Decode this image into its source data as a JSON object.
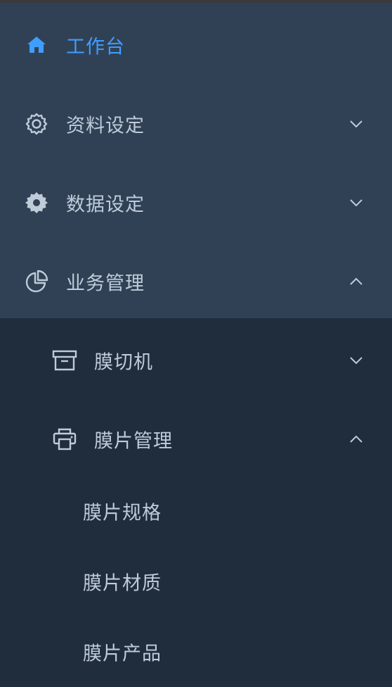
{
  "menu": {
    "items": [
      {
        "label": "工作台",
        "icon": "home-icon",
        "active": true
      },
      {
        "label": "资料设定",
        "icon": "gear-outline-icon",
        "expanded": false
      },
      {
        "label": "数据设定",
        "icon": "gear-filled-icon",
        "expanded": false
      },
      {
        "label": "业务管理",
        "icon": "pie-chart-icon",
        "expanded": true
      }
    ],
    "business_children": [
      {
        "label": "膜切机",
        "icon": "box-icon",
        "expanded": false
      },
      {
        "label": "膜片管理",
        "icon": "printer-icon",
        "expanded": true
      }
    ],
    "film_children": [
      {
        "label": "膜片规格"
      },
      {
        "label": "膜片材质"
      },
      {
        "label": "膜片产品"
      }
    ]
  },
  "colors": {
    "sidebar_top_bg": "#304156",
    "sidebar_sub_bg": "#1f2d3d",
    "text": "#bfcbd9",
    "active": "#409eff"
  }
}
